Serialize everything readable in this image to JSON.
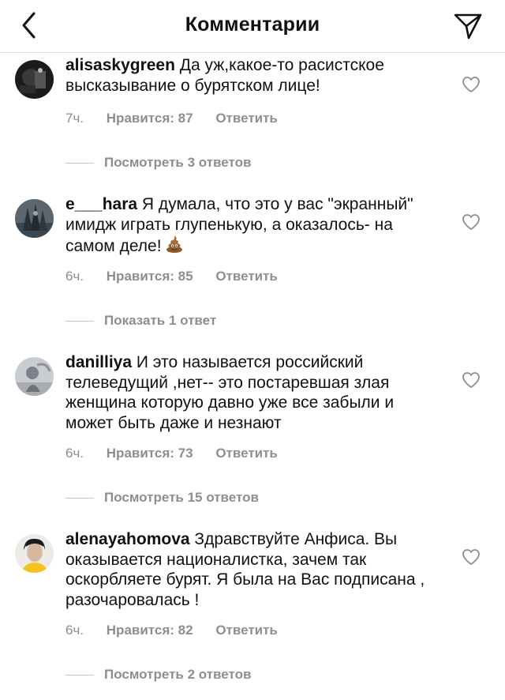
{
  "header": {
    "title": "Комментарии"
  },
  "comments": [
    {
      "username": "alisaskygreen",
      "text": "Да уж,какое-то расистское высказывание о бурятском лице!",
      "time": "7ч.",
      "likes": "Нравится: 87",
      "reply": "Ответить",
      "view_replies": "Посмотреть 3 ответов"
    },
    {
      "username": "e___hara",
      "text": "Я думала, что это у вас \"экранный\" имидж играть глупенькую, а оказалось- на самом деле!",
      "emoji": "pile-of-poo",
      "time": "6ч.",
      "likes": "Нравится: 85",
      "reply": "Ответить",
      "view_replies": "Показать 1 ответ"
    },
    {
      "username": "danilliya",
      "text": "И это называется российский телеведущий ,нет-- это постаревшая злая женщина которую давно уже все забыли и может быть даже и незнают",
      "time": "6ч.",
      "likes": "Нравится: 73",
      "reply": "Ответить",
      "view_replies": "Посмотреть 15 ответов"
    },
    {
      "username": "alenayahomova",
      "text": "Здравствуйте Анфиса. Вы оказывается националистка, зачем так оскорбляете бурят. Я была на Вас подписана , разочаровалась !",
      "time": "6ч.",
      "likes": "Нравится: 82",
      "reply": "Ответить",
      "view_replies": "Посмотреть 2 ответов"
    }
  ]
}
